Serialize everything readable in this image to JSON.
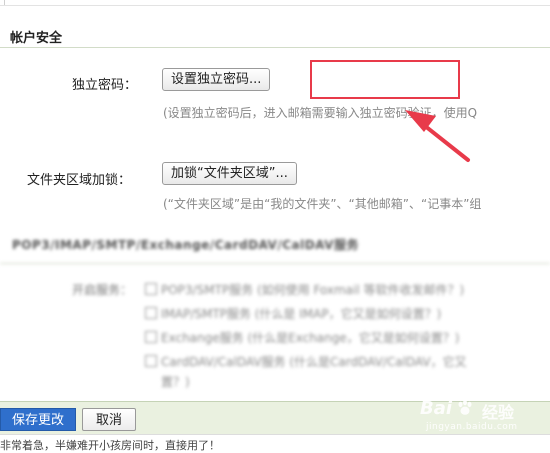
{
  "section": {
    "title": "帐户安全"
  },
  "password": {
    "label": "独立密码：",
    "button": "设置独立密码...",
    "hint": "(设置独立密码后，进入邮箱需要输入独立密码验证，使用Q"
  },
  "folder_lock": {
    "label": "文件夹区域加锁：",
    "button": "加锁“文件夹区域”...",
    "hint": "(“文件夹区域”是由“我的文件夹”、“其他邮箱”、“记事本”组"
  },
  "services": {
    "title": "POP3/IMAP/SMTP/Exchange/CardDAV/CalDAV服务",
    "enable_label": "开启服务：",
    "options": [
      {
        "label": "POP3/SMTP服务 (如何使用 Foxmail 等软件收发邮件？)"
      },
      {
        "label": "IMAP/SMTP服务 (什么是 IMAP，它又是如何设置？)"
      },
      {
        "label": "Exchange服务 (什么是Exchange，它又是如何设置？)"
      },
      {
        "label": "CardDAV/CalDAV服务 (什么是CardDAV/CalDAV，它又"
      },
      {
        "label": "置？)"
      }
    ]
  },
  "footer": {
    "save_label": "保存更改",
    "cancel_label": "取消",
    "bottom_text": "非常着急，半嫌难开小孩房间时，直接用了！"
  },
  "watermark": {
    "brand": "Bai",
    "brand_cn": "经验",
    "url": "jingyan.baidu.com"
  },
  "colors": {
    "annotation": "#e83a4a",
    "save_button": "#2f6fcc",
    "footer_bg": "#eaf1e0"
  }
}
